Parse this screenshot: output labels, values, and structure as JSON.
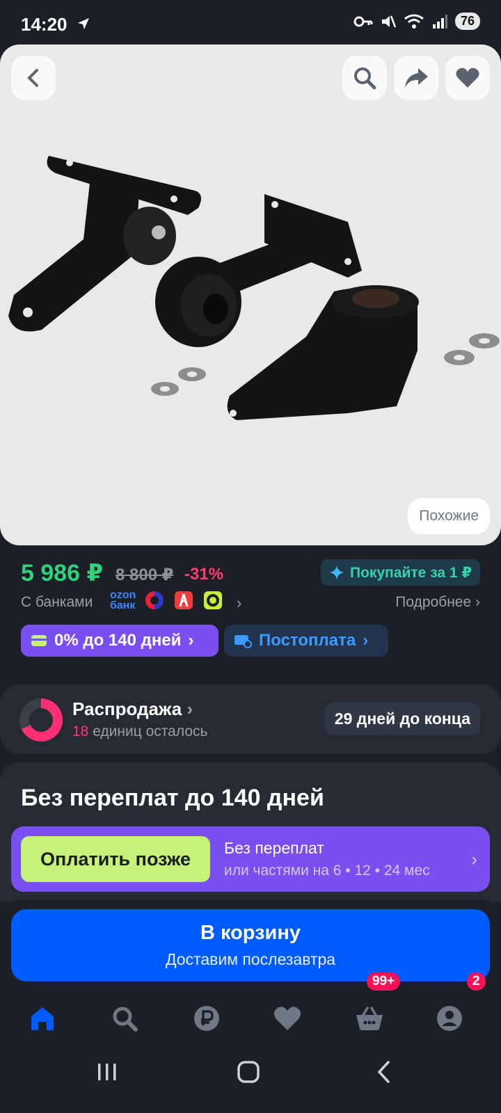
{
  "status_bar": {
    "time": "14:20",
    "battery": "76",
    "network_sub": "5"
  },
  "gallery": {
    "similar_label": "Похожие"
  },
  "price": {
    "current": "5 986 ₽",
    "old": "8 800 ₽",
    "discount": "-31%",
    "buy_for_1": "Покупайте за 1 ₽",
    "banks_label": "С банками",
    "ozon_bank_line1": "ozon",
    "ozon_bank_line2": "банк",
    "more_link": "Подробнее",
    "installment_pill": "0% до 140 дней",
    "postpay_pill": "Постоплата"
  },
  "sale": {
    "title": "Распродажа",
    "count_number": "18",
    "count_text": "единиц осталось",
    "days_left": "29 дней до конца",
    "remaining_fraction": 0.68
  },
  "installment": {
    "title": "Без переплат до 140 дней",
    "pay_later_button": "Оплатить позже",
    "line1": "Без переплат",
    "line2": "или частями на 6 • 12 • 24 мес"
  },
  "cart": {
    "title": "В корзину",
    "subtitle": "Доставим послезавтра"
  },
  "bottom_nav": {
    "items": [
      "home-icon",
      "search-icon",
      "ruble-icon",
      "heart-icon",
      "basket-icon",
      "profile-icon"
    ],
    "active": "home-icon",
    "cart_badge": "99+",
    "profile_badge": "2"
  },
  "colors": {
    "accent_blue": "#005bff",
    "price_green": "#2fd27a",
    "discount_red": "#ff3c6d",
    "installment_purple": "#7a4ff0",
    "pay_later_lime": "#c7f27a",
    "badge_pink": "#f91155"
  }
}
